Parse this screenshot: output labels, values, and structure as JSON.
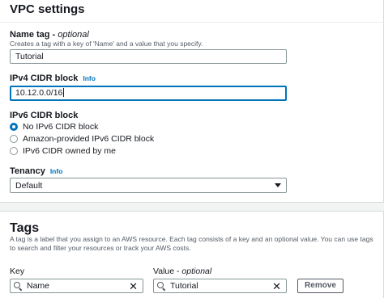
{
  "vpc_settings": {
    "title": "VPC settings",
    "name_tag": {
      "label": "Name tag - ",
      "label_optional": "optional",
      "hint": "Creates a tag with a key of 'Name' and a value that you specify.",
      "value": "Tutorial"
    },
    "ipv4": {
      "label": "IPv4 CIDR block",
      "info": "Info",
      "value": "10.12.0.0/16"
    },
    "ipv6": {
      "label": "IPv6 CIDR block",
      "options": [
        {
          "label": "No IPv6 CIDR block",
          "selected": true
        },
        {
          "label": "Amazon-provided IPv6 CIDR block",
          "selected": false
        },
        {
          "label": "IPv6 CIDR owned by me",
          "selected": false
        }
      ]
    },
    "tenancy": {
      "label": "Tenancy",
      "info": "Info",
      "value": "Default"
    }
  },
  "tags": {
    "title": "Tags",
    "description": "A tag is a label that you assign to an AWS resource. Each tag consists of a key and an optional value. You can use tags to search and filter your resources or track your AWS costs.",
    "key_label": "Key",
    "value_label": "Value - ",
    "value_label_optional": "optional",
    "rows": [
      {
        "key": "Name",
        "value": "Tutorial",
        "remove_label": "Remove"
      }
    ]
  }
}
